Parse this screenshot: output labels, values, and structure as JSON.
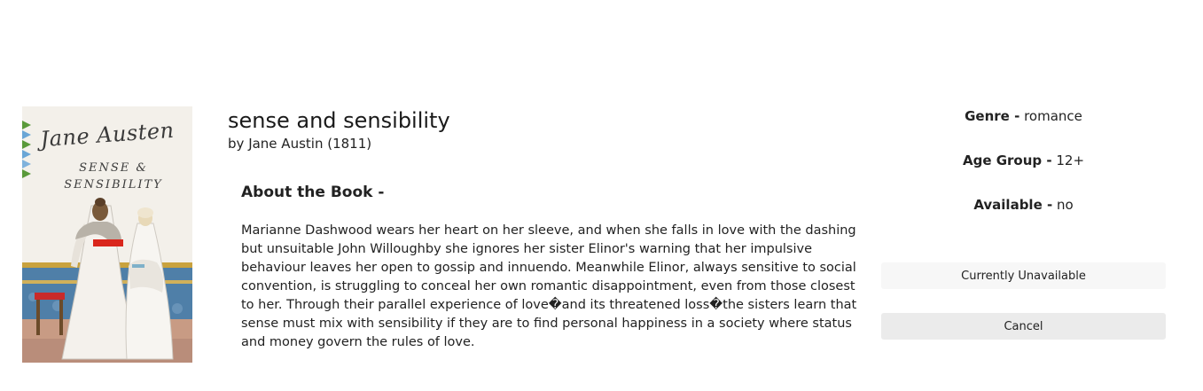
{
  "book": {
    "cover": {
      "author_text": "Jane Austen",
      "title_line1": "SENSE &",
      "title_line2": "SENSIBILITY"
    },
    "title": "sense and sensibility",
    "by_prefix": "by",
    "author": "Jane Austin",
    "year": "(1811)",
    "about_heading": "About the Book -",
    "description": "Marianne Dashwood wears her heart on her sleeve, and when she falls in love with the dashing but unsuitable John Willoughby she ignores her sister Elinor's warning that her impulsive behaviour leaves her open to gossip and innuendo. Meanwhile Elinor, always sensitive to social convention, is struggling to conceal her own romantic disappointment, even from those closest to her. Through their parallel experience of love�and its threatened loss�the sisters learn that sense must mix with sensibility if they are to find personal happiness in a society where status and money govern the rules of love."
  },
  "details": {
    "genre_label": "Genre -",
    "genre_value": "romance",
    "age_label": "Age Group -",
    "age_value": "12+",
    "available_label": "Available -",
    "available_value": "no"
  },
  "actions": {
    "status_button": "Currently Unavailable",
    "cancel_button": "Cancel"
  }
}
